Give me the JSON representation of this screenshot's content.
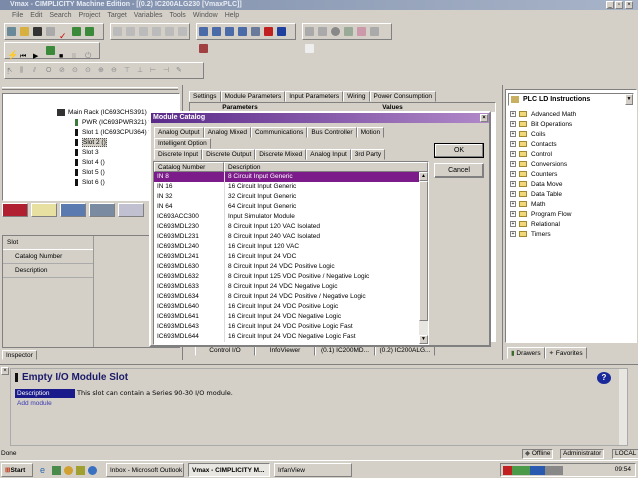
{
  "window": {
    "title": "Vmax - CIMPLICITY Machine Edition - [(0.2) IC200ALG230 [VmaxPLC]]"
  },
  "menu": [
    "File",
    "Edit",
    "Search",
    "Project",
    "Target",
    "Variables",
    "Tools",
    "Window",
    "Help"
  ],
  "project_tree": {
    "items": [
      {
        "label": "Main Rack (IC693CHS391)",
        "type": "rack"
      },
      {
        "label": "PWR (IC693PWR321) *",
        "type": "pwr"
      },
      {
        "label": "Slot 1 (IC693CPU364) *",
        "type": "slot"
      },
      {
        "label": "Slot 2 ()",
        "type": "slot",
        "selected": true
      },
      {
        "label": "Slot 3",
        "type": "slot"
      },
      {
        "label": "Slot 4 ()",
        "type": "slot"
      },
      {
        "label": "Slot 5 ()",
        "type": "slot"
      },
      {
        "label": "Slot 6 ()",
        "type": "slot"
      }
    ]
  },
  "inspector": {
    "section": "Slot",
    "fields": [
      "Catalog Number",
      "Description"
    ],
    "tab": "Inspector"
  },
  "editor": {
    "tabs": [
      "Settings",
      "Module Parameters",
      "Input Parameters",
      "Wiring",
      "Power Consumption"
    ],
    "columns": [
      "Parameters",
      "Values"
    ],
    "bottom_tabs": [
      "Control I/O",
      "InfoViewer",
      "(0.1) IC200MD...",
      "(0.2) IC200ALG..."
    ]
  },
  "toolbox": {
    "title": "PLC LD Instructions",
    "items": [
      "Advanced Math",
      "Bit Operations",
      "Coils",
      "Contacts",
      "Control",
      "Conversions",
      "Counters",
      "Data Move",
      "Data Table",
      "Math",
      "Program Flow",
      "Relational",
      "Timers"
    ],
    "tabs": [
      "Drawers",
      "Favorites"
    ]
  },
  "dialog": {
    "title": "Module Catalog",
    "close": "×",
    "tabs_row1": [
      "Analog Output",
      "Analog Mixed",
      "Communications",
      "Bus Controller",
      "Motion"
    ],
    "tabs_row2": [
      "Intelligent Option"
    ],
    "tabs_row3": [
      "Discrete Input",
      "Discrete Output",
      "Discrete Mixed",
      "Analog Input",
      "3rd Party"
    ],
    "columns": [
      "Catalog Number",
      "Description"
    ],
    "rows": [
      [
        "IN 8",
        "8 Circuit Input Generic"
      ],
      [
        "IN 16",
        "16 Circuit Input Generic"
      ],
      [
        "IN 32",
        "32 Circuit Input Generic"
      ],
      [
        "IN 64",
        "64 Circuit Input Generic"
      ],
      [
        "IC693ACC300",
        "Input Simulator Module"
      ],
      [
        "IC693MDL230",
        "8 Circuit Input 120 VAC Isolated"
      ],
      [
        "IC693MDL231",
        "8 Circuit Input 240 VAC Isolated"
      ],
      [
        "IC693MDL240",
        "16 Circuit Input 120 VAC"
      ],
      [
        "IC693MDL241",
        "16 Circuit Input 24 VDC"
      ],
      [
        "IC693MDL630",
        "8 Circuit Input 24 VDC Positive Logic"
      ],
      [
        "IC693MDL632",
        "8 Circuit Input 125 VDC Positive / Negative Logic"
      ],
      [
        "IC693MDL633",
        "8 Circuit Input 24 VDC Negative Logic"
      ],
      [
        "IC693MDL634",
        "8 Circuit Input 24 VDC Positive / Negative Logic"
      ],
      [
        "IC693MDL640",
        "16 Circuit Input 24 VDC Positive Logic"
      ],
      [
        "IC693MDL641",
        "16 Circuit Input 24 VDC Negative Logic"
      ],
      [
        "IC693MDL643",
        "16 Circuit Input 24 VDC Positive Logic Fast"
      ],
      [
        "IC693MDL644",
        "16 Circuit Input 24 VDC Negative Logic Fast"
      ]
    ],
    "ok": "OK",
    "cancel": "Cancel"
  },
  "info": {
    "title": "Empty I/O Module Slot",
    "label": "Description",
    "text": "This slot can contain a Series 90-30 I/O module.",
    "link": "Add module"
  },
  "status": {
    "left": "Done",
    "mode": "Offline",
    "user": "Administrator",
    "location": "LOCAL"
  },
  "taskbar": {
    "start": "Start",
    "tasks": [
      "Inbox - Microsoft Outlook",
      "Vmax - CIMPLICITY M...",
      "IrfanView"
    ],
    "clock": "09:54"
  },
  "colors": {
    "selection": "#7b1c8a",
    "title_active": "#5a2a8a"
  }
}
